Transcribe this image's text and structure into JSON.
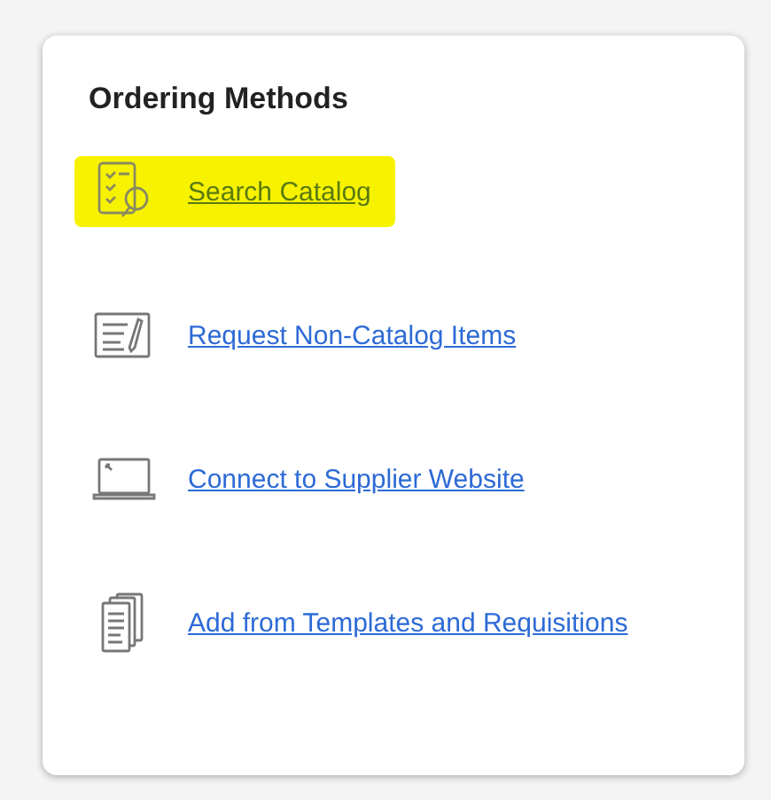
{
  "card": {
    "title": "Ordering Methods",
    "items": [
      {
        "kind": "catalog",
        "label": "Search Catalog",
        "highlighted": true
      },
      {
        "kind": "form",
        "label": "Request Non-Catalog Items",
        "highlighted": false
      },
      {
        "kind": "laptop",
        "label": "Connect to Supplier Website",
        "highlighted": false
      },
      {
        "kind": "documents",
        "label": "Add from Templates and Requisitions",
        "highlighted": false
      }
    ]
  }
}
